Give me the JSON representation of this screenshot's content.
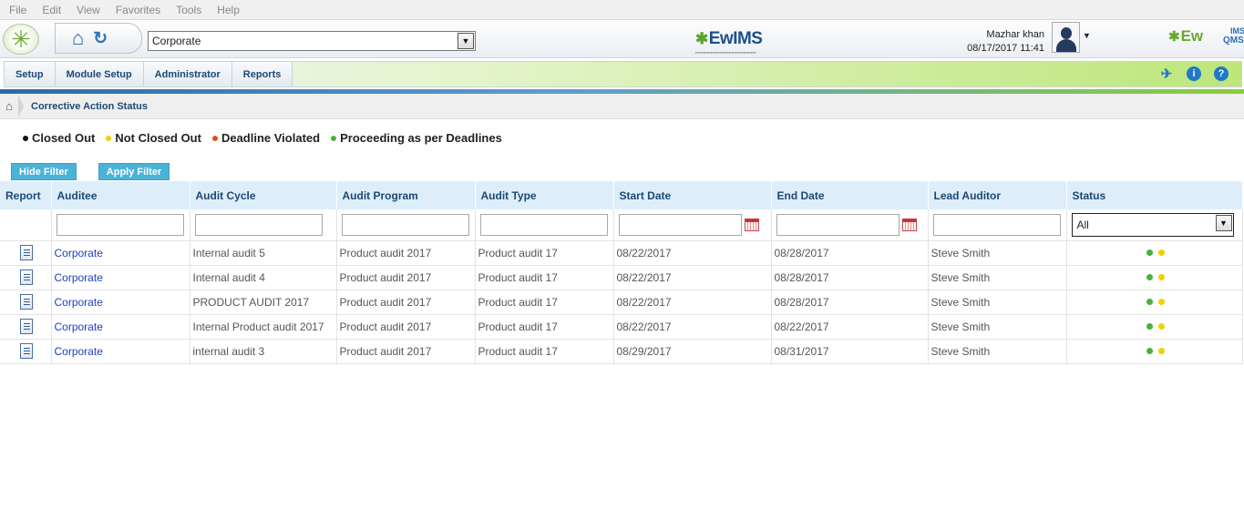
{
  "menu": [
    "File",
    "Edit",
    "View",
    "Favorites",
    "Tools",
    "Help"
  ],
  "org_select": {
    "value": "Corporate"
  },
  "center_logo": {
    "text": "EwIMS"
  },
  "right_logo": {
    "text": "Ew",
    "qms": "QMS",
    "ims": "IMS"
  },
  "user": {
    "name": "Mazhar khan",
    "datetime": "08/17/2017 11:41"
  },
  "nav": {
    "items": [
      "Setup",
      "Module Setup",
      "Administrator",
      "Reports"
    ]
  },
  "icons": {
    "pin": "pin-icon",
    "info": "info-icon",
    "help": "help-icon",
    "home": "home-icon",
    "refresh": "refresh-icon",
    "report": "report-document-icon",
    "calendar": "calendar-icon"
  },
  "breadcrumb": {
    "title": "Corrective Action Status"
  },
  "legend": [
    {
      "label": "Closed Out",
      "color": "#111111"
    },
    {
      "label": "Not Closed Out",
      "color": "#f0d000"
    },
    {
      "label": "Deadline Violated",
      "color": "#e0501a"
    },
    {
      "label": "Proceeding as per Deadlines",
      "color": "#4caf3e"
    }
  ],
  "buttons": {
    "hide_filter": "Hide Filter",
    "apply_filter": "Apply Filter"
  },
  "table": {
    "headers": [
      "Report",
      "Auditee",
      "Audit Cycle",
      "Audit Program",
      "Audit Type",
      "Start Date",
      "End Date",
      "Lead Auditor",
      "Status"
    ],
    "status_filter": "All",
    "status_dot_colors": [
      "#4caf3e",
      "#f0d000"
    ],
    "rows": [
      {
        "auditee": "Corporate",
        "cycle": "Internal audit 5",
        "program": "Product audit 2017",
        "type": "Product audit 17",
        "start": "08/22/2017",
        "end": "08/28/2017",
        "lead": "Steve Smith"
      },
      {
        "auditee": "Corporate",
        "cycle": "Internal audit 4",
        "program": "Product audit 2017",
        "type": "Product audit 17",
        "start": "08/22/2017",
        "end": "08/28/2017",
        "lead": "Steve Smith"
      },
      {
        "auditee": "Corporate",
        "cycle": "PRODUCT AUDIT 2017",
        "program": "Product audit 2017",
        "type": "Product audit 17",
        "start": "08/22/2017",
        "end": "08/28/2017",
        "lead": "Steve Smith"
      },
      {
        "auditee": "Corporate",
        "cycle": "Internal Product audit 2017",
        "program": "Product audit 2017",
        "type": "Product audit 17",
        "start": "08/22/2017",
        "end": "08/22/2017",
        "lead": "Steve Smith"
      },
      {
        "auditee": "Corporate",
        "cycle": "internal audit 3",
        "program": "Product audit 2017",
        "type": "Product audit 17",
        "start": "08/29/2017",
        "end": "08/31/2017",
        "lead": "Steve Smith"
      }
    ]
  }
}
